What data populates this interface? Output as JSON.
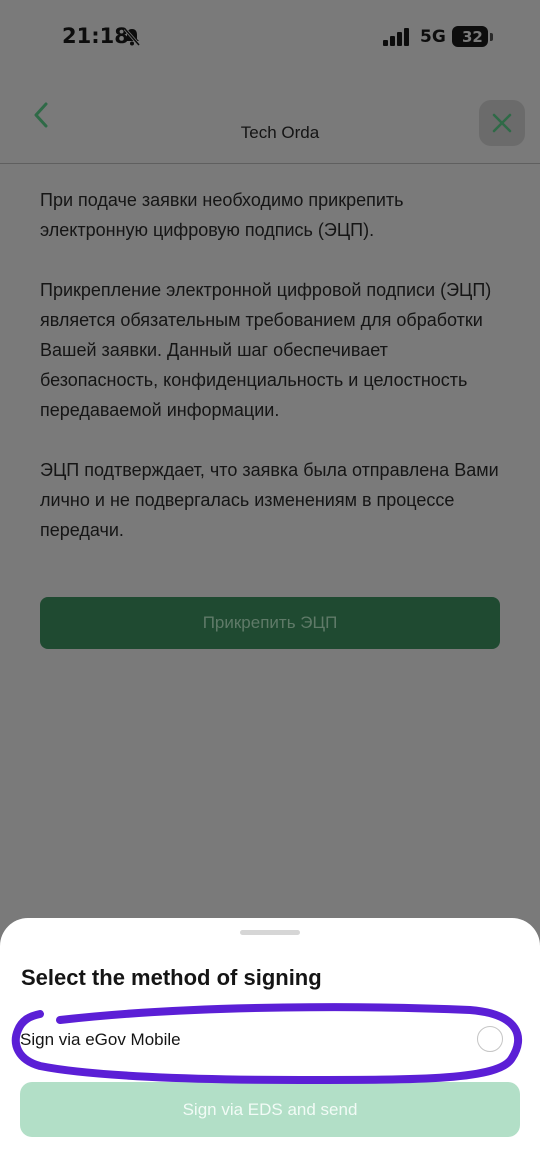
{
  "status_bar": {
    "time": "21:18",
    "network": "5G",
    "battery": "32",
    "icons": [
      "bell-muted-icon",
      "signal-icon",
      "battery-icon"
    ]
  },
  "header": {
    "title": "Tech Orda",
    "back_icon": "chevron-left-icon",
    "close_icon": "close-icon",
    "accent_color": "#2f6a47"
  },
  "content": {
    "paragraphs": [
      "При подаче заявки необходимо прикрепить электронную цифровую подпись (ЭЦП).",
      "Прикрепление электронной цифровой подписи (ЭЦП) является обязательным требованием для обработки Вашей заявки. Данный шаг обеспечивает безопасность, конфиденциальность и целостность передаваемой информации.",
      "ЭЦП подтверждает, что заявка была отправлена Вами лично и не подвергалась изменениям в процессе передачи."
    ],
    "attach_button_label": "Прикрепить ЭЦП"
  },
  "sheet": {
    "title": "Select the method of signing",
    "option_label": "Sign via eGov Mobile",
    "option_selected": false,
    "send_button_label": "Sign via EDS and send",
    "send_button_color": "#b2dfc7"
  },
  "annotation": {
    "color": "#5b1fd6"
  }
}
